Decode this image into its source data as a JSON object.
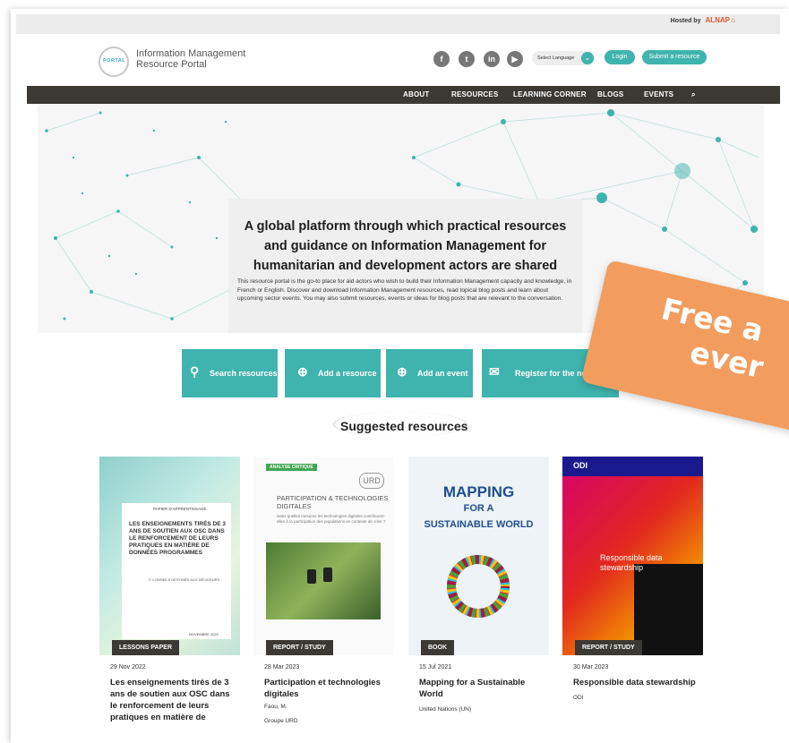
{
  "hosted": {
    "label": "Hosted by",
    "brand": "ALNAP"
  },
  "header": {
    "logo_text": "PORTAL",
    "title_line1": "Information Management",
    "title_line2": "Resource Portal"
  },
  "social": [
    {
      "icon": "facebook-icon",
      "glyph": "f"
    },
    {
      "icon": "twitter-icon",
      "glyph": "t"
    },
    {
      "icon": "linkedin-icon",
      "glyph": "in"
    },
    {
      "icon": "youtube-icon",
      "glyph": "▶"
    }
  ],
  "language": {
    "label": "Select Language"
  },
  "auth": {
    "login": "Login",
    "submit": "Submit a resource"
  },
  "nav": {
    "items": [
      "ABOUT",
      "RESOURCES",
      "LEARNING CORNER",
      "BLOGS",
      "EVENTS"
    ]
  },
  "hero": {
    "title": "A global platform through which practical resources and guidance on Information Management for humanitarian and development actors are shared",
    "description": "This resource portal is the go-to place for aid actors who wish to build their Information Management capacity and knowledge, in French or English. Discover and download Information Management resources, read topical blog posts and learn about upcoming sector events. You may also submit resources, events or ideas for blog posts that are relevant to the conversation."
  },
  "actions": [
    "Search resources",
    "Add a resource",
    "Add an event",
    "Register for the newsletter"
  ],
  "suggested": {
    "title": "Suggested resources"
  },
  "cards": [
    {
      "tag": "LESSONS PAPER",
      "date": "29 Nov 2022",
      "title": "Les enseignements tirés de 3 ans de soutien aux OSC dans le renforcement de leurs pratiques en matière de",
      "author": "",
      "org": "",
      "cover_label": "PAPIER D'APPRENTISSAGE",
      "cover_title": "LES ENSEIGNEMENTS TIRÉS DE 3 ANS DE SOUTIEN AUX OSC DANS LE RENFORCEMENT DE LEURS PRATIQUES EN MATIÈRE DE DONNÉES PROGRAMMES",
      "cover_sub": "© CONSEILS DESTINÉS AUX DÉCIDEURS",
      "cover_date": "NOVEMBRE 2022"
    },
    {
      "tag": "REPORT / STUDY",
      "date": "28 Mar 2023",
      "title": "Participation et technologies digitales",
      "author": "Faou, M.",
      "org": "Groupe URD",
      "cover_label": "ANALYSE CRITIQUE",
      "cover_title": "PARTICIPATION & TECHNOLOGIES DIGITALES",
      "cover_sub": "Dans quelles mesures les technologies digitales contribuent-elles à la participation des populations en contexte de crise ?",
      "cover_logo": "URD"
    },
    {
      "tag": "BOOK",
      "date": "15 Jul 2021",
      "title": "Mapping for a Sustainable World",
      "author": "United Nations (UN)",
      "org": "",
      "cover_line1": "MAPPING",
      "cover_line2": "FOR A",
      "cover_line3": "SUSTAINABLE WORLD"
    },
    {
      "tag": "REPORT / STUDY",
      "date": "30 Mar 2023",
      "title": "Responsible data stewardship",
      "author": "ODI",
      "org": "",
      "cover_logo": "ODI",
      "cover_title": "Responsible data stewardship"
    }
  ],
  "banner": {
    "line1": "Free a",
    "line2": "ever"
  },
  "colors": {
    "teal": "#3fb3ae",
    "nav": "#3c3934",
    "banner": "#f29d5e",
    "alnap": "#e0572b"
  }
}
